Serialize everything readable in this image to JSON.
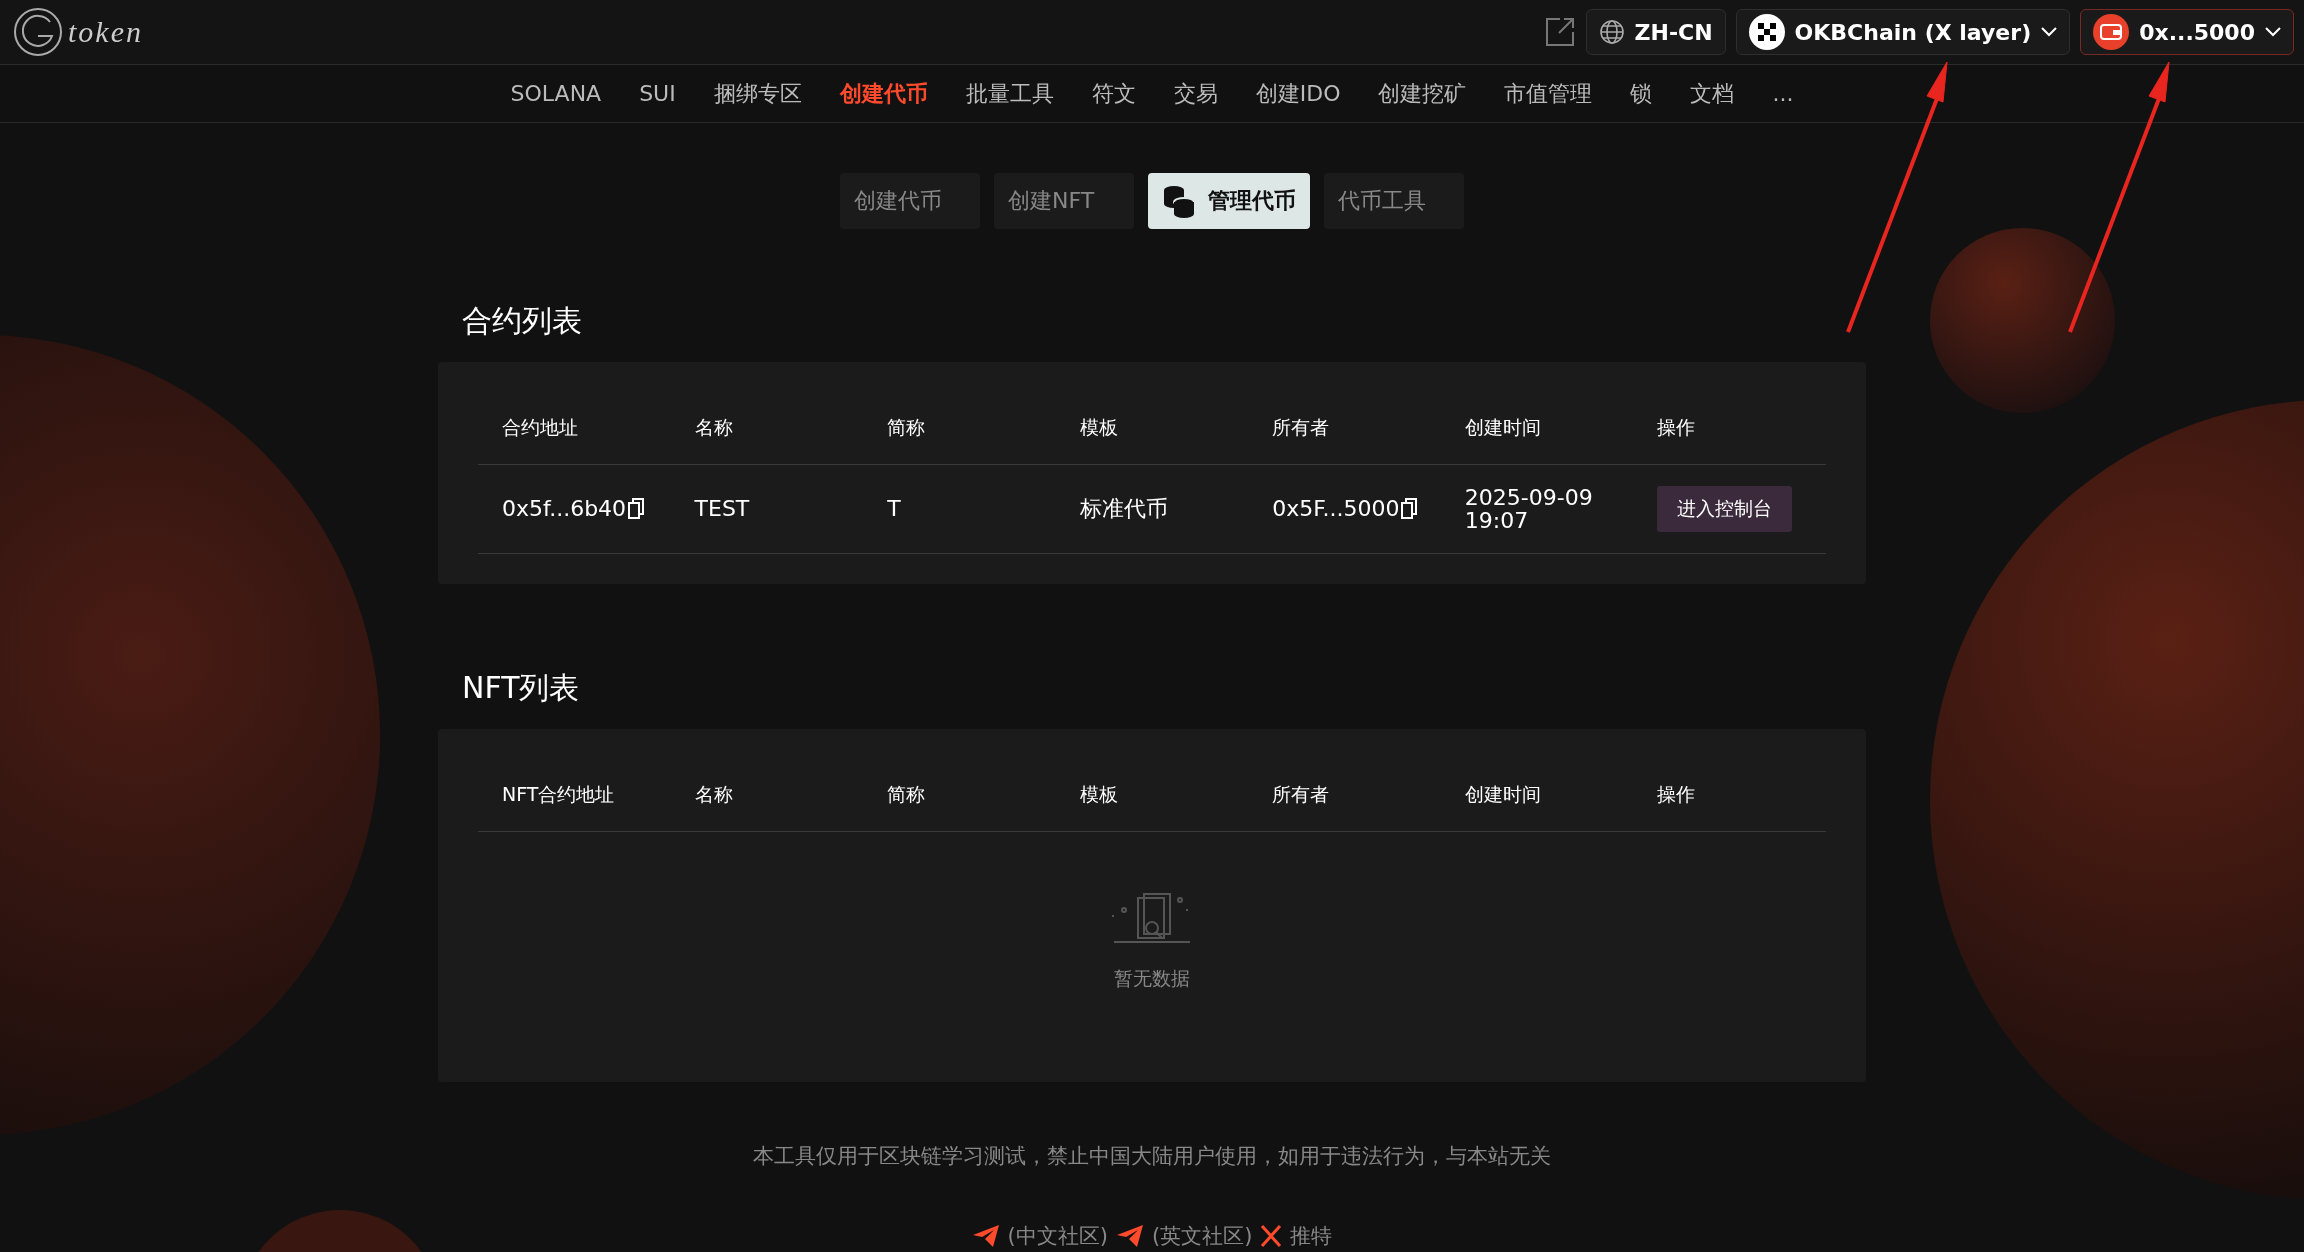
{
  "logo": {
    "text": "token"
  },
  "header": {
    "language": "ZH-CN",
    "network": "OKBChain (X layer)",
    "wallet": "0x...5000"
  },
  "nav": [
    {
      "label": "SOLANA",
      "selected": false
    },
    {
      "label": "SUI",
      "selected": false
    },
    {
      "label": "捆绑专区",
      "selected": false
    },
    {
      "label": "创建代币",
      "selected": true
    },
    {
      "label": "批量工具",
      "selected": false
    },
    {
      "label": "符文",
      "selected": false
    },
    {
      "label": "交易",
      "selected": false
    },
    {
      "label": "创建IDO",
      "selected": false
    },
    {
      "label": "创建挖矿",
      "selected": false
    },
    {
      "label": "市值管理",
      "selected": false
    },
    {
      "label": "锁",
      "selected": false
    },
    {
      "label": "文档",
      "selected": false
    },
    {
      "label": "...",
      "selected": false
    }
  ],
  "sub_tabs": [
    {
      "label": "创建代币",
      "selected": false
    },
    {
      "label": "创建NFT",
      "selected": false
    },
    {
      "label": "管理代币",
      "selected": true
    },
    {
      "label": "代币工具",
      "selected": false
    }
  ],
  "sections": [
    {
      "title": "合约列表",
      "columns": [
        "合约地址",
        "名称",
        "简称",
        "模板",
        "所有者",
        "创建时间",
        "操作"
      ],
      "rows": [
        [
          {
            "kind": "copy",
            "text": "0x5f...6b40"
          },
          {
            "kind": "text",
            "text": "TEST"
          },
          {
            "kind": "text",
            "text": "T"
          },
          {
            "kind": "text",
            "text": "标准代币"
          },
          {
            "kind": "copy",
            "text": "0x5F...5000"
          },
          {
            "kind": "text",
            "text": "2025-09-09\n19:07"
          },
          {
            "kind": "button",
            "text": "进入控制台"
          }
        ]
      ]
    },
    {
      "title": "NFT列表",
      "columns": [
        "NFT合约地址",
        "名称",
        "简称",
        "模板",
        "所有者",
        "创建时间",
        "操作"
      ],
      "empty_text": "暂无数据"
    }
  ],
  "footer": {
    "disclaimer": "本工具仅用于区块链学习测试，禁止中国大陆用户使用，如用于违法行为，与本站无关",
    "links": [
      {
        "kind": "telegram",
        "label": "(中文社区)"
      },
      {
        "kind": "telegram",
        "label": "(英文社区)"
      },
      {
        "kind": "x",
        "label": "推特"
      }
    ]
  }
}
